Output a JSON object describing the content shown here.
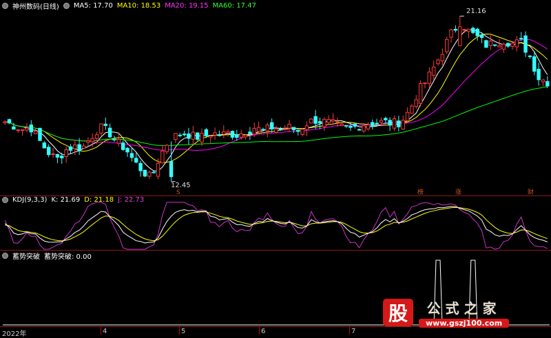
{
  "main_header": {
    "title": "神州数码(日线)",
    "ma5": "MA5: 17.70",
    "ma10": "MA10: 18.53",
    "ma20": "MA20: 19.15",
    "ma60": "MA60: 17.47"
  },
  "kdj_header": {
    "name": "KDJ(9,3,3)",
    "k": "K: 21.69",
    "d": "D: 21.18",
    "j": "J: 22.73"
  },
  "xsts_header": {
    "name": "蓄势突破",
    "value": "蓄势突破: 0.00"
  },
  "annotations": {
    "high": "21.16",
    "low": "12.45",
    "event_s": "S",
    "event_1": "榜",
    "event_2": "涨",
    "event_3": "财"
  },
  "x_labels": [
    "2022年",
    "4",
    "5",
    "6",
    "7"
  ],
  "watermark": {
    "glyph": "股",
    "title": "公式之家",
    "url": "www.gszj100.com"
  },
  "colors": {
    "up": "#ff3a3a",
    "down": "#33ffff",
    "ma5": "#ffffff",
    "ma10": "#ffff00",
    "ma20": "#ff00ff",
    "ma60": "#00ff00",
    "kdj_k": "#ffffff",
    "kdj_d": "#ffff00",
    "kdj_j": "#cc33cc",
    "panel_line": "#8a1a1a"
  },
  "chart_data": [
    {
      "type": "candlestick",
      "title": "神州数码(日线)",
      "ylim": [
        12.0,
        21.5
      ],
      "high": 21.16,
      "low": 12.45,
      "series": [
        {
          "name": "MA5",
          "last": 17.7
        },
        {
          "name": "MA10",
          "last": 18.53
        },
        {
          "name": "MA20",
          "last": 19.15
        },
        {
          "name": "MA60",
          "last": 17.47
        }
      ],
      "close_path": [
        15.6,
        15.4,
        15.2,
        15.3,
        14.6,
        14.0,
        13.6,
        14.1,
        14.3,
        14.2,
        14.8,
        15.3,
        15.1,
        14.5,
        14.2,
        13.5,
        13.0,
        12.6,
        13.8,
        14.6,
        14.9,
        15.0,
        14.8,
        14.8,
        15.0,
        14.9,
        15.0,
        14.9,
        15.1,
        15.3,
        15.1,
        15.3,
        15.2,
        15.3,
        15.1,
        15.5,
        15.7,
        15.6,
        15.5,
        15.3,
        15.2,
        15.4,
        15.5,
        15.5,
        15.6,
        15.5,
        15.6,
        16.2,
        17.2,
        17.8,
        18.6,
        19.5,
        20.4,
        20.8,
        20.3,
        20.0,
        19.6,
        19.8,
        19.9,
        19.7,
        19.8,
        19.0,
        17.9,
        17.7
      ]
    },
    {
      "type": "line",
      "title": "KDJ(9,3,3)",
      "series": [
        {
          "name": "K",
          "last": 21.69
        },
        {
          "name": "D",
          "last": 21.18
        },
        {
          "name": "J",
          "last": 22.73
        }
      ]
    },
    {
      "type": "line",
      "title": "蓄势突破",
      "series": [
        {
          "name": "蓄势突破",
          "last": 0.0,
          "spikes": 2
        }
      ]
    }
  ]
}
